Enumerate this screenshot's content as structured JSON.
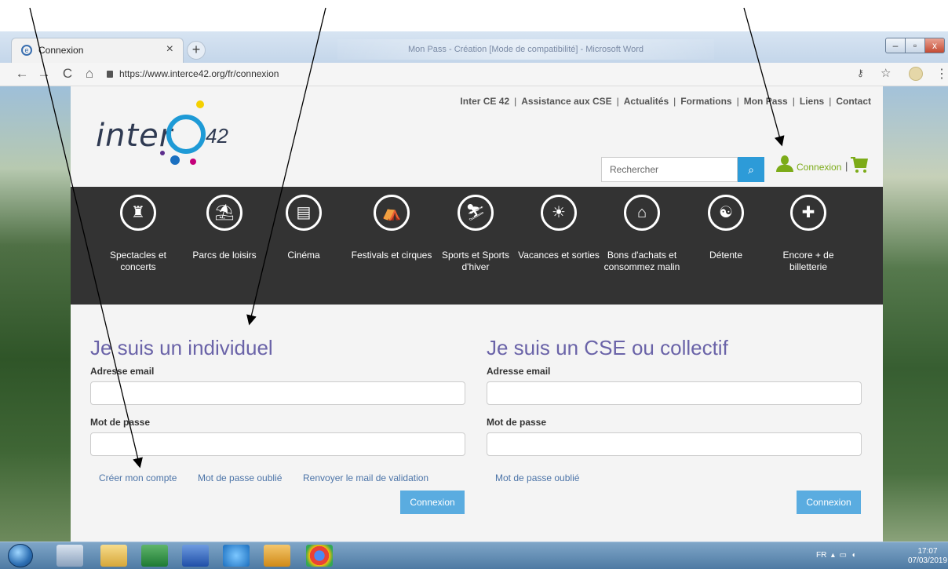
{
  "browser": {
    "tab_title": "Connexion",
    "tab_close": "×",
    "new_tab": "+",
    "background_window_title": "Mon Pass - Création [Mode de compatibilité] - Microsoft Word",
    "url": "https://www.interce42.org/fr/connexion",
    "nav": {
      "back": "←",
      "forward": "→",
      "reload": "C",
      "home": "⌂"
    },
    "window_buttons": {
      "minimize": "–",
      "maximize": "▫",
      "close": "x"
    },
    "icons": {
      "key": "key-icon",
      "star": "star-icon",
      "extension": "extension-icon",
      "menu": "menu-icon"
    }
  },
  "site": {
    "logo": {
      "text": "inter",
      "number": "42",
      "letter": "e"
    },
    "top_nav": [
      "Inter CE 42",
      "Assistance aux CSE",
      "Actualités",
      "Formations",
      "Mon Pass",
      "Liens",
      "Contact"
    ],
    "top_nav_separator": "|",
    "search_placeholder": "Rechercher",
    "search_icon": "🔍",
    "connexion_link": "Connexion",
    "connexion_separator": "|",
    "colors": {
      "accent_green": "#7cab18",
      "accent_blue": "#2d9bd8",
      "heading_purple": "#6a63a8",
      "dark_bar": "#333333"
    }
  },
  "categories": [
    {
      "label": "Spectacles et concerts",
      "icon": "theater-icon",
      "glyph": "🎭"
    },
    {
      "label": "Parcs de loisirs",
      "icon": "carousel-icon",
      "glyph": "🎠"
    },
    {
      "label": "Cinéma",
      "icon": "clapperboard-icon",
      "glyph": "🎬"
    },
    {
      "label": "Festivals et cirques",
      "icon": "circus-tent-icon",
      "glyph": "⛺"
    },
    {
      "label": "Sports et Sports d'hiver",
      "icon": "skier-icon",
      "glyph": "⛷"
    },
    {
      "label": "Vacances et sorties",
      "icon": "beach-chair-icon",
      "glyph": "☀"
    },
    {
      "label": "Bons d'achats et consommez malin",
      "icon": "gift-icon",
      "glyph": "🎁"
    },
    {
      "label": "Détente",
      "icon": "meditation-icon",
      "glyph": "☯"
    },
    {
      "label": "Encore + de billetterie",
      "icon": "ticket-icon",
      "glyph": "🎟"
    }
  ],
  "form_individual": {
    "title": "Je suis un individuel",
    "email_label": "Adresse email",
    "email_value": "",
    "password_label": "Mot de passe",
    "password_value": "",
    "links": [
      "Créer mon compte",
      "Mot de passe oublié",
      "Renvoyer le mail de validation"
    ],
    "submit": "Connexion"
  },
  "form_cse": {
    "title": "Je suis un CSE ou collectif",
    "email_label": "Adresse email",
    "email_value": "",
    "password_label": "Mot de passe",
    "password_value": "",
    "links": [
      "Mot de passe oublié"
    ],
    "submit": "Connexion"
  },
  "taskbar": {
    "language": "FR",
    "time": "17:07",
    "date": "07/03/2019",
    "apps": [
      "calculator-icon",
      "file-explorer-icon",
      "excel-icon",
      "word-icon",
      "internet-explorer-icon",
      "outlook-icon",
      "chrome-icon"
    ]
  }
}
